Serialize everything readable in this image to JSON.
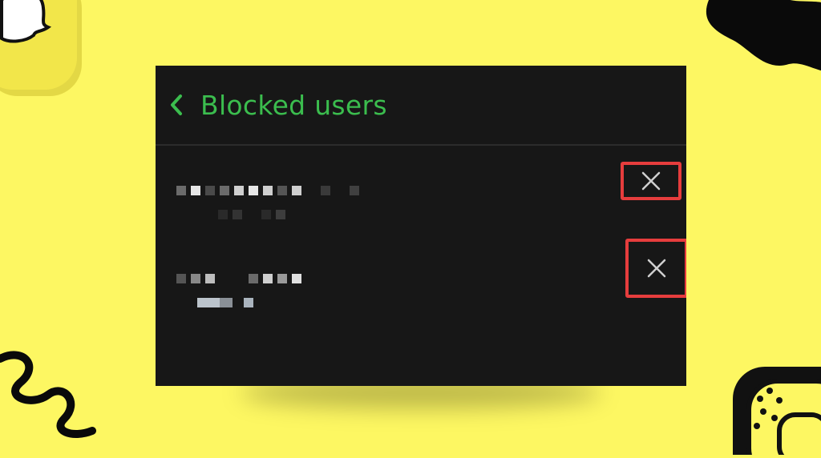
{
  "header": {
    "title": "Blocked users"
  },
  "icons": {
    "back": "chevron-left-icon",
    "remove": "close-icon"
  },
  "colors": {
    "background": "#fdf762",
    "panel": "#171717",
    "accent": "#3bbd4e",
    "highlight": "#e63d3d"
  },
  "blocked_list": [
    {
      "display_name": "",
      "username": ""
    },
    {
      "display_name": "",
      "username": ""
    }
  ]
}
